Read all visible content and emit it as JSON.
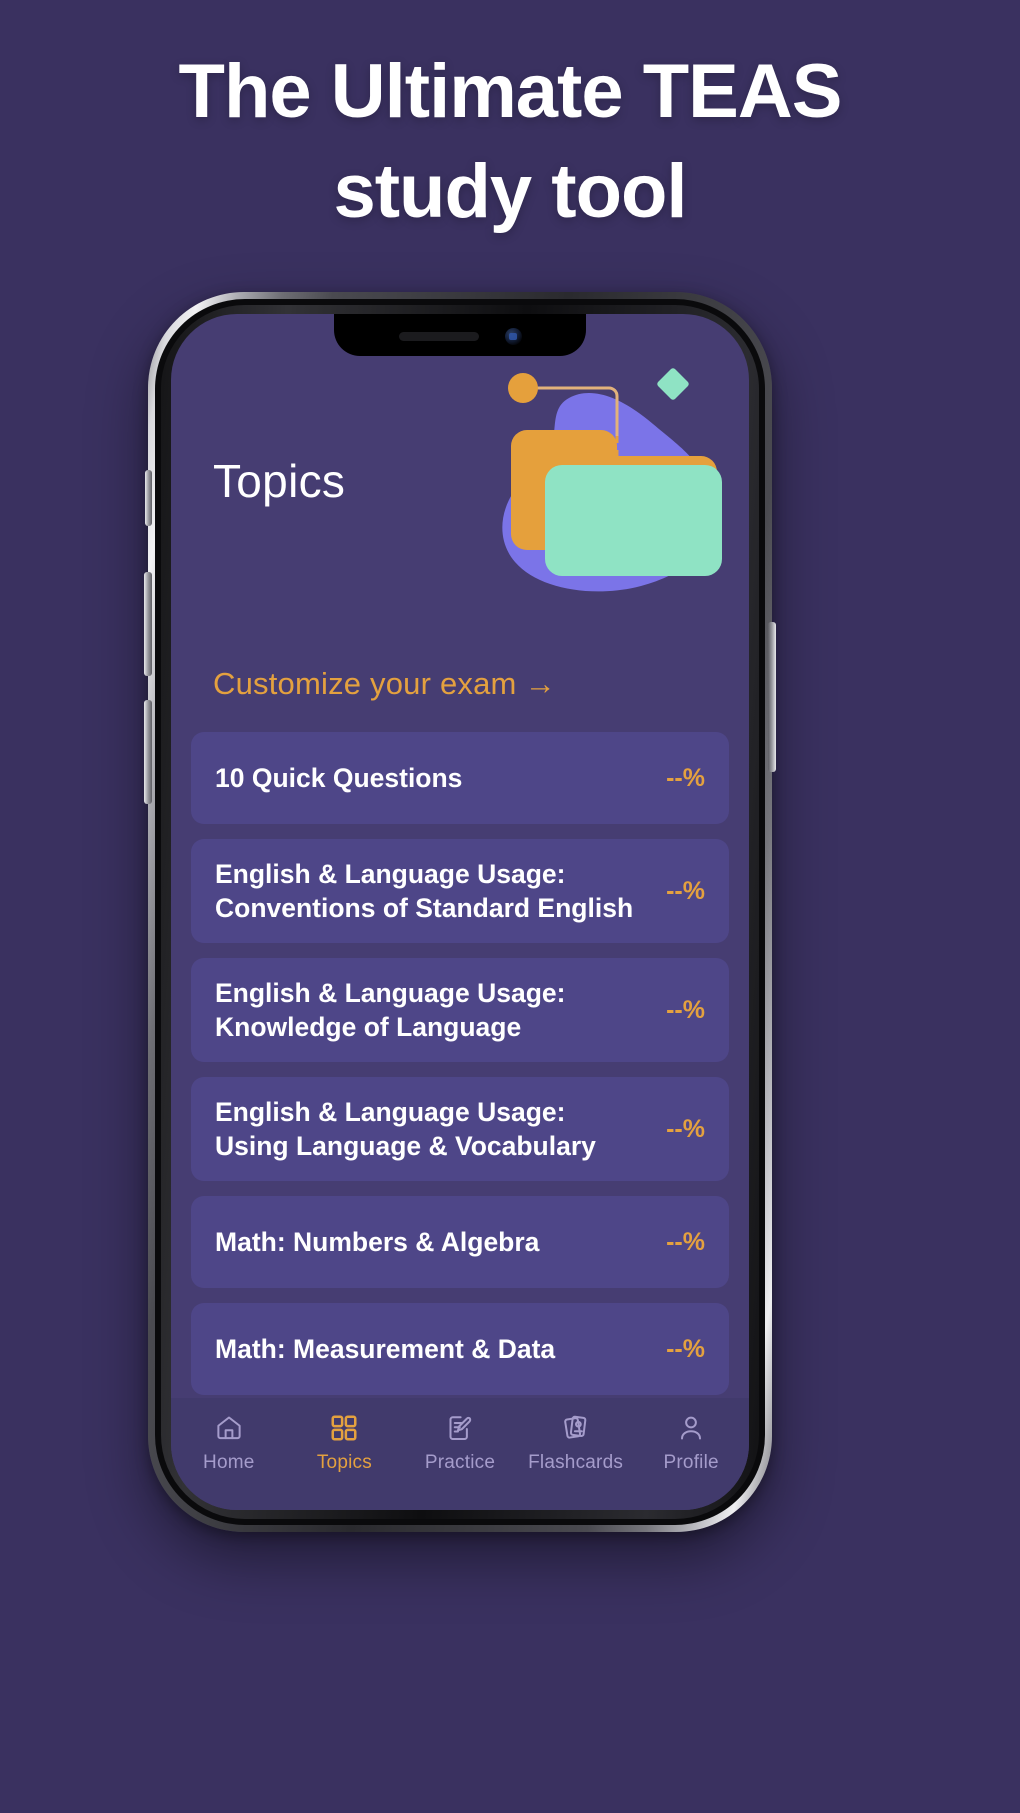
{
  "promo": {
    "headline_line1": "The Ultimate TEAS",
    "headline_line2": "study tool"
  },
  "colors": {
    "page_background": "#3a3160",
    "screen_background": "#463d72",
    "card_background": "#4e4688",
    "accent_orange": "#e4a13f",
    "tabbar_background": "#413a6c",
    "tab_inactive": "#a59ccb",
    "illus_purple": "#7b74e8",
    "illus_orange": "#e5a03c",
    "illus_teal": "#8fe3c4"
  },
  "app": {
    "page_title": "Topics",
    "illustration": {
      "name": "folders-illustration",
      "shapes": [
        "blob",
        "folder-orange",
        "folder-teal",
        "dot-orange",
        "diamond-teal",
        "connector-line"
      ]
    },
    "customize_link": {
      "label": "Customize your exam",
      "arrow": "→"
    },
    "topics": [
      {
        "title": "10 Quick Questions",
        "title2": "",
        "percent": "--%"
      },
      {
        "title": "English & Language Usage:",
        "title2": "Conventions of Standard English",
        "percent": "--%"
      },
      {
        "title": "English & Language Usage:",
        "title2": "Knowledge of Language",
        "percent": "--%"
      },
      {
        "title": "English & Language Usage:",
        "title2": "Using Language & Vocabulary",
        "percent": "--%"
      },
      {
        "title": "Math: Numbers & Algebra",
        "title2": "",
        "percent": "--%"
      },
      {
        "title": "Math: Measurement & Data",
        "title2": "",
        "percent": "--%"
      }
    ],
    "tabs": [
      {
        "label": "Home",
        "icon": "home-icon",
        "active": false
      },
      {
        "label": "Topics",
        "icon": "grid-icon",
        "active": true
      },
      {
        "label": "Practice",
        "icon": "note-pencil-icon",
        "active": false
      },
      {
        "label": "Flashcards",
        "icon": "cards-icon",
        "active": false
      },
      {
        "label": "Profile",
        "icon": "person-icon",
        "active": false
      }
    ]
  }
}
